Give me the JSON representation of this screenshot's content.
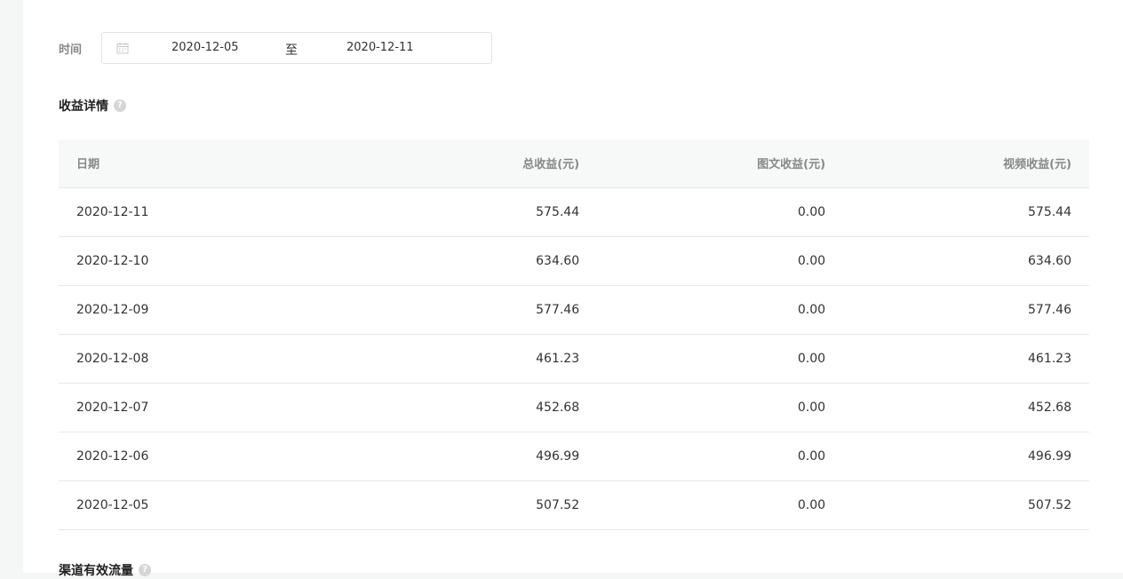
{
  "filter": {
    "time_label": "时间",
    "start_date": "2020-12-05",
    "separator": "至",
    "end_date": "2020-12-11"
  },
  "earnings": {
    "title": "收益详情",
    "help": "?",
    "columns": [
      "日期",
      "总收益(元)",
      "图文收益(元)",
      "视频收益(元)"
    ],
    "rows": [
      {
        "date": "2020-12-11",
        "total": "575.44",
        "article": "0.00",
        "video": "575.44"
      },
      {
        "date": "2020-12-10",
        "total": "634.60",
        "article": "0.00",
        "video": "634.60"
      },
      {
        "date": "2020-12-09",
        "total": "577.46",
        "article": "0.00",
        "video": "577.46"
      },
      {
        "date": "2020-12-08",
        "total": "461.23",
        "article": "0.00",
        "video": "461.23"
      },
      {
        "date": "2020-12-07",
        "total": "452.68",
        "article": "0.00",
        "video": "452.68"
      },
      {
        "date": "2020-12-06",
        "total": "496.99",
        "article": "0.00",
        "video": "496.99"
      },
      {
        "date": "2020-12-05",
        "total": "507.52",
        "article": "0.00",
        "video": "507.52"
      }
    ]
  },
  "channel": {
    "title": "渠道有效流量",
    "help": "?"
  }
}
